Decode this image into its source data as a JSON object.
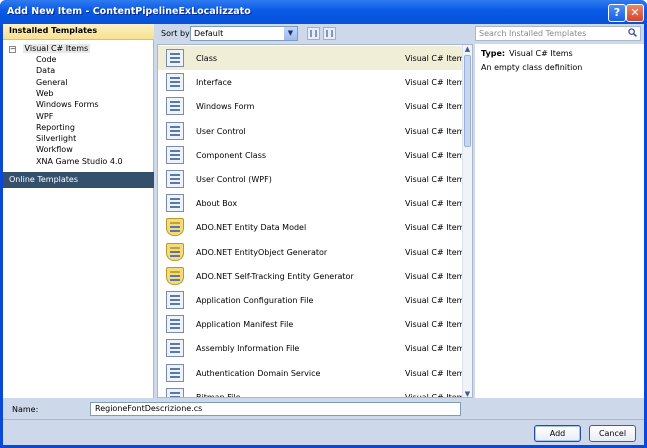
{
  "window": {
    "title": "Add New Item - ContentPipelineExLocalizzato",
    "help": "?",
    "close": "✕"
  },
  "left": {
    "header": "Installed Templates",
    "root_expander": "−",
    "root": "Visual C# Items",
    "children": [
      "Code",
      "Data",
      "General",
      "Web",
      "Windows Forms",
      "WPF",
      "Reporting",
      "Silverlight",
      "Workflow",
      "XNA Game Studio 4.0"
    ],
    "online": "Online Templates"
  },
  "toolbar": {
    "sort_label": "Sort by:",
    "sort_value": "Default",
    "arrow": "▼"
  },
  "search": {
    "placeholder": "Search Installed Templates"
  },
  "items": [
    {
      "name": "Class",
      "category": "Visual C# Items",
      "selected": true
    },
    {
      "name": "Interface",
      "category": "Visual C# Items"
    },
    {
      "name": "Windows Form",
      "category": "Visual C# Items"
    },
    {
      "name": "User Control",
      "category": "Visual C# Items"
    },
    {
      "name": "Component Class",
      "category": "Visual C# Items"
    },
    {
      "name": "User Control (WPF)",
      "category": "Visual C# Items"
    },
    {
      "name": "About Box",
      "category": "Visual C# Items"
    },
    {
      "name": "ADO.NET Entity Data Model",
      "category": "Visual C# Items"
    },
    {
      "name": "ADO.NET EntityObject Generator",
      "category": "Visual C# Items"
    },
    {
      "name": "ADO.NET Self-Tracking Entity Generator",
      "category": "Visual C# Items"
    },
    {
      "name": "Application Configuration File",
      "category": "Visual C# Items"
    },
    {
      "name": "Application Manifest File",
      "category": "Visual C# Items"
    },
    {
      "name": "Assembly Information File",
      "category": "Visual C# Items"
    },
    {
      "name": "Authentication Domain Service",
      "category": "Visual C# Items"
    },
    {
      "name": "Bitmap File",
      "category": "Visual C# Items"
    }
  ],
  "scroll": {
    "up": "▲",
    "down": "▼"
  },
  "details": {
    "type_label": "Type:",
    "type_value": "Visual C# Items",
    "description": "An empty class definition"
  },
  "name_field": {
    "label": "Name:",
    "value": "RegioneFontDescrizione.cs"
  },
  "buttons": {
    "add": "Add",
    "cancel": "Cancel"
  }
}
